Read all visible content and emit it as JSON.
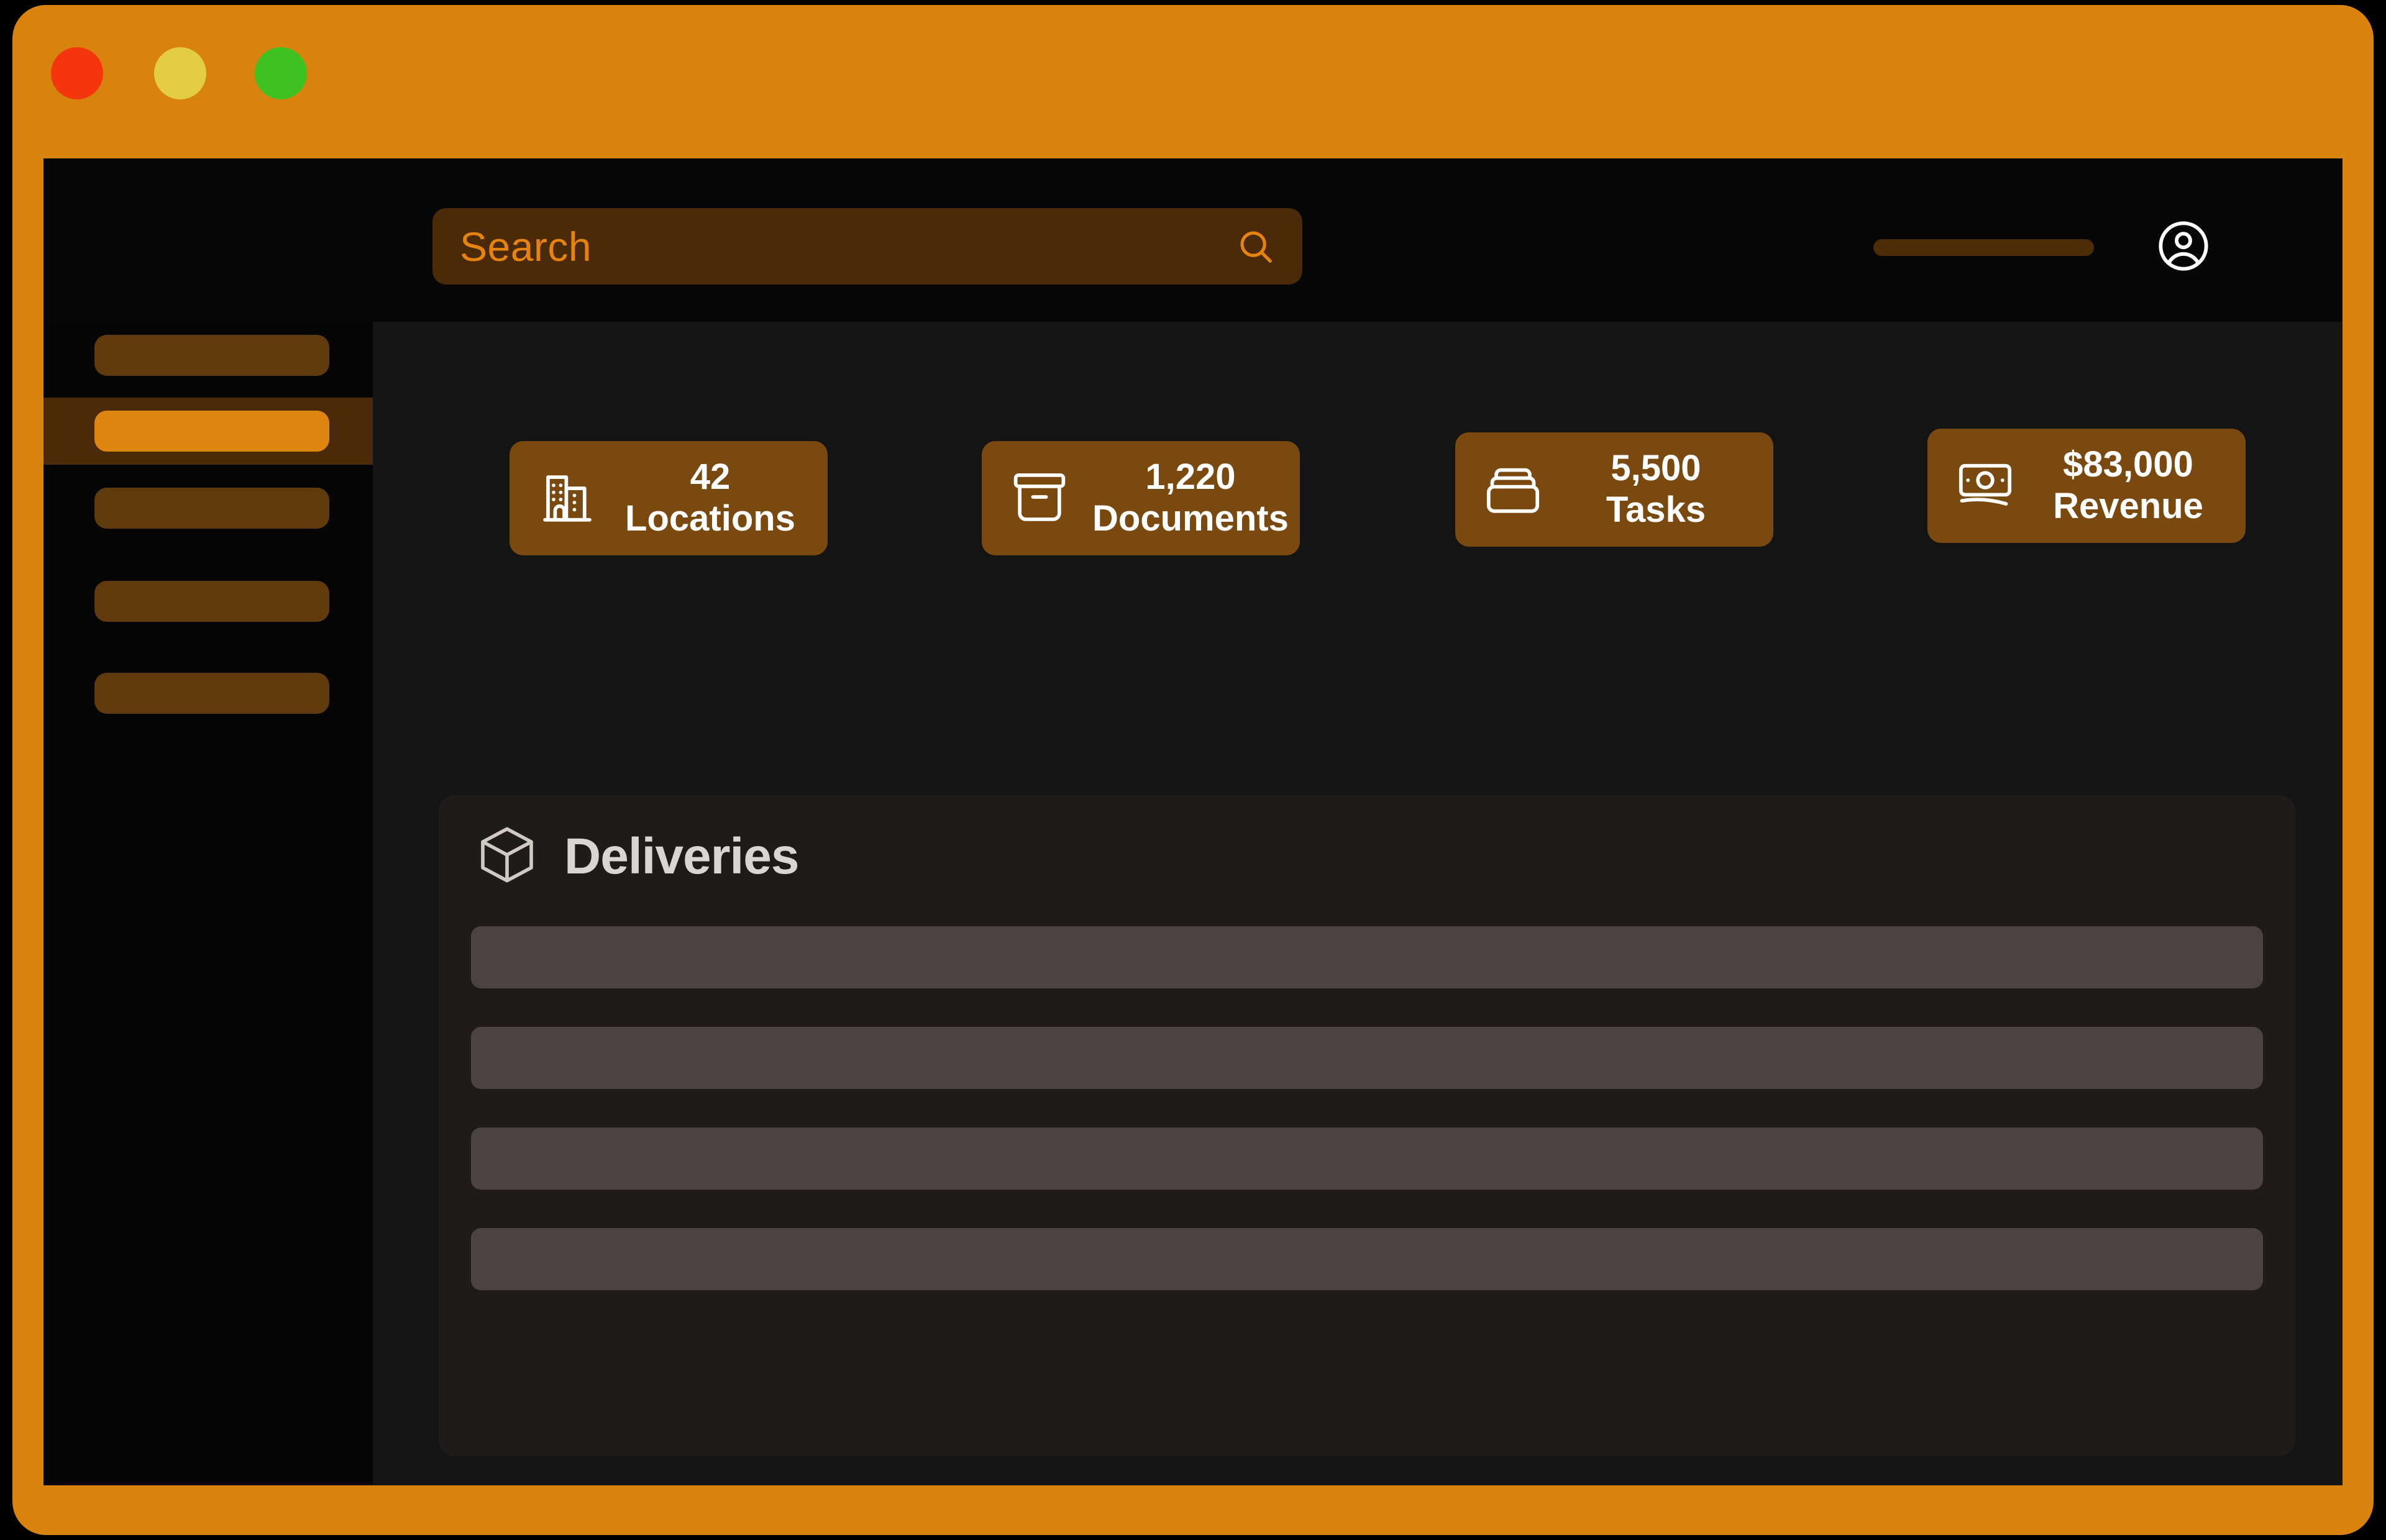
{
  "window": {
    "frame_color": "#d9830f",
    "traffic_lights": [
      {
        "name": "close",
        "color": "#f5360d"
      },
      {
        "name": "minimize",
        "color": "#e3cd45"
      },
      {
        "name": "maximize",
        "color": "#3dc221"
      }
    ]
  },
  "header": {
    "search": {
      "placeholder": "Search",
      "value": "",
      "icon": "search-icon",
      "background": "#4a2a08",
      "text_color": "#e6830f"
    },
    "placeholder_pill": {
      "color": "#4d2d08"
    },
    "account": {
      "icon": "user-circle-icon",
      "color": "#ffffff"
    }
  },
  "sidebar": {
    "background": "#050505",
    "active_index": 1,
    "active_row_background": "#4a2a08",
    "active_bar_color": "#de850f",
    "inactive_bar_color": "#5f3a0c",
    "items": [
      {
        "label": "",
        "name": "sidebar-item-1"
      },
      {
        "label": "",
        "name": "sidebar-item-2"
      },
      {
        "label": "",
        "name": "sidebar-item-3"
      },
      {
        "label": "",
        "name": "sidebar-item-4"
      },
      {
        "label": "",
        "name": "sidebar-item-5"
      }
    ]
  },
  "main": {
    "background": "#141414",
    "stats": {
      "card_background": "#79490f",
      "cards": [
        {
          "value": "42",
          "label": "Locations",
          "icon": "buildings-icon"
        },
        {
          "value": "1,220",
          "label": "Documents",
          "icon": "archive-box-icon"
        },
        {
          "value": "5,500",
          "label": "Tasks",
          "icon": "stacked-boxes-icon"
        },
        {
          "value": "$83,000",
          "label": "Revenue",
          "icon": "banknote-icon"
        }
      ]
    },
    "deliveries": {
      "title": "Deliveries",
      "icon": "cube-icon",
      "panel_background": "#1f1b1a",
      "row_color": "#4b4342",
      "rows": [
        {
          "label": ""
        },
        {
          "label": ""
        },
        {
          "label": ""
        },
        {
          "label": ""
        }
      ]
    }
  }
}
